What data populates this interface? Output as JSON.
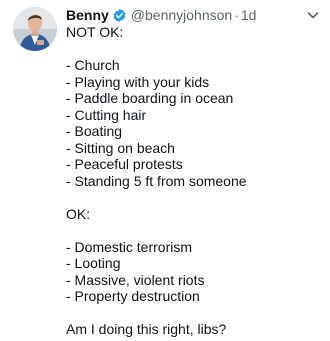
{
  "tweet": {
    "author": {
      "display_name": "Benny",
      "handle": "@bennyjohnson",
      "verified": true,
      "avatar_icon": "profile-photo-icon"
    },
    "separator": "·",
    "time": "1d",
    "menu_icon": "chevron-down-icon",
    "colors": {
      "text": "#0f1419",
      "secondary": "#5b6570",
      "verified": "#1d9bf0"
    },
    "body": {
      "heading_not_ok": "NOT OK:",
      "not_ok_items": [
        "- Church",
        "- Playing with your kids",
        "- Paddle boarding in ocean",
        "- Cutting hair",
        "- Boating",
        "- Sitting on beach",
        "- Peaceful protests",
        "- Standing 5 ft from someone"
      ],
      "heading_ok": "OK:",
      "ok_items": [
        "- Domestic terrorism",
        "- Looting",
        "- Massive, violent riots",
        "- Property destruction"
      ],
      "closing": "Am I doing this right, libs?"
    }
  }
}
